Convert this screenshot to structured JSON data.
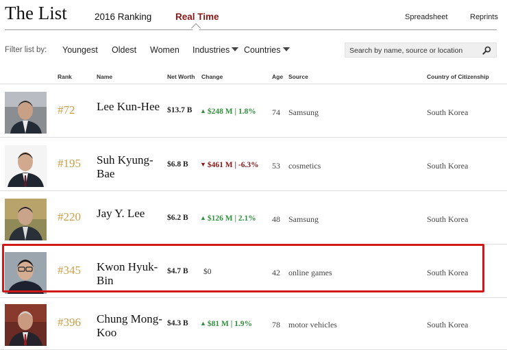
{
  "header": {
    "title": "The List",
    "nav": [
      "2016 Ranking",
      "Real Time"
    ],
    "active_nav": "Real Time",
    "spreadsheet": "Spreadsheet",
    "reprints": "Reprints"
  },
  "filters": {
    "label": "Filter list by:",
    "youngest": "Youngest",
    "oldest": "Oldest",
    "women": "Women",
    "industries": "Industries",
    "countries": "Countries",
    "search_placeholder": "Search by name, source or location"
  },
  "columns": {
    "rank": "Rank",
    "name": "Name",
    "net_worth": "Net Worth",
    "change": "Change",
    "age": "Age",
    "source": "Source",
    "country": "Country of Citizenship"
  },
  "rows": [
    {
      "rank": "#72",
      "name": "Lee Kun-Hee",
      "net_worth": "$13.7 B",
      "change": "$248 M | 1.8%",
      "direction": "up",
      "age": "74",
      "source": "Samsung",
      "country": "South Korea"
    },
    {
      "rank": "#195",
      "name": "Suh Kyung-Bae",
      "net_worth": "$6.8 B",
      "change": "$461 M | -6.3%",
      "direction": "down",
      "age": "53",
      "source": "cosmetics",
      "country": "South Korea"
    },
    {
      "rank": "#220",
      "name": "Jay Y. Lee",
      "net_worth": "$6.2 B",
      "change": "$126 M | 2.1%",
      "direction": "up",
      "age": "48",
      "source": "Samsung",
      "country": "South Korea"
    },
    {
      "rank": "#345",
      "name": "Kwon Hyuk-Bin",
      "net_worth": "$4.7 B",
      "change": "$0",
      "direction": "flat",
      "age": "42",
      "source": "online games",
      "country": "South Korea",
      "highlighted": true
    },
    {
      "rank": "#396",
      "name": "Chung Mong-Koo",
      "net_worth": "$4.3 B",
      "change": "$81 M | 1.9%",
      "direction": "up",
      "age": "78",
      "source": "motor vehicles",
      "country": "South Korea"
    }
  ],
  "colors": {
    "accent": "#8a1616",
    "rank": "#c9a14a",
    "up": "#2f8f3a",
    "down": "#8a1616",
    "highlight_border": "#d01818"
  }
}
